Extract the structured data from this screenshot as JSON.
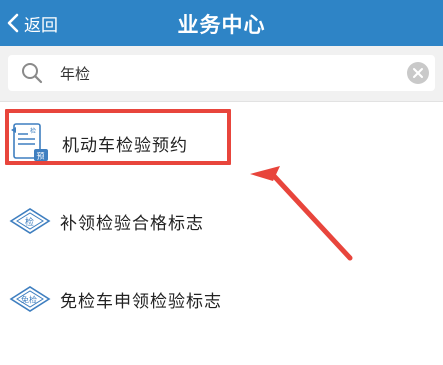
{
  "header": {
    "back_label": "返回",
    "title": "业务中心",
    "bg_color": "#2e84c6"
  },
  "search": {
    "value": "年检",
    "icon": "search-icon",
    "clear_icon": "clear-icon"
  },
  "items": [
    {
      "label": "机动车检验预约",
      "icon": "inspection-booking-icon",
      "icon_text_a": "检",
      "icon_text_b": "预"
    },
    {
      "label": "补领检验合格标志",
      "icon": "inspection-sign-icon",
      "icon_text": "检"
    },
    {
      "label": "免检车申领检验标志",
      "icon": "exempt-sign-icon",
      "icon_text": "免检"
    }
  ],
  "annotation": {
    "highlight_color": "#e8453c"
  }
}
